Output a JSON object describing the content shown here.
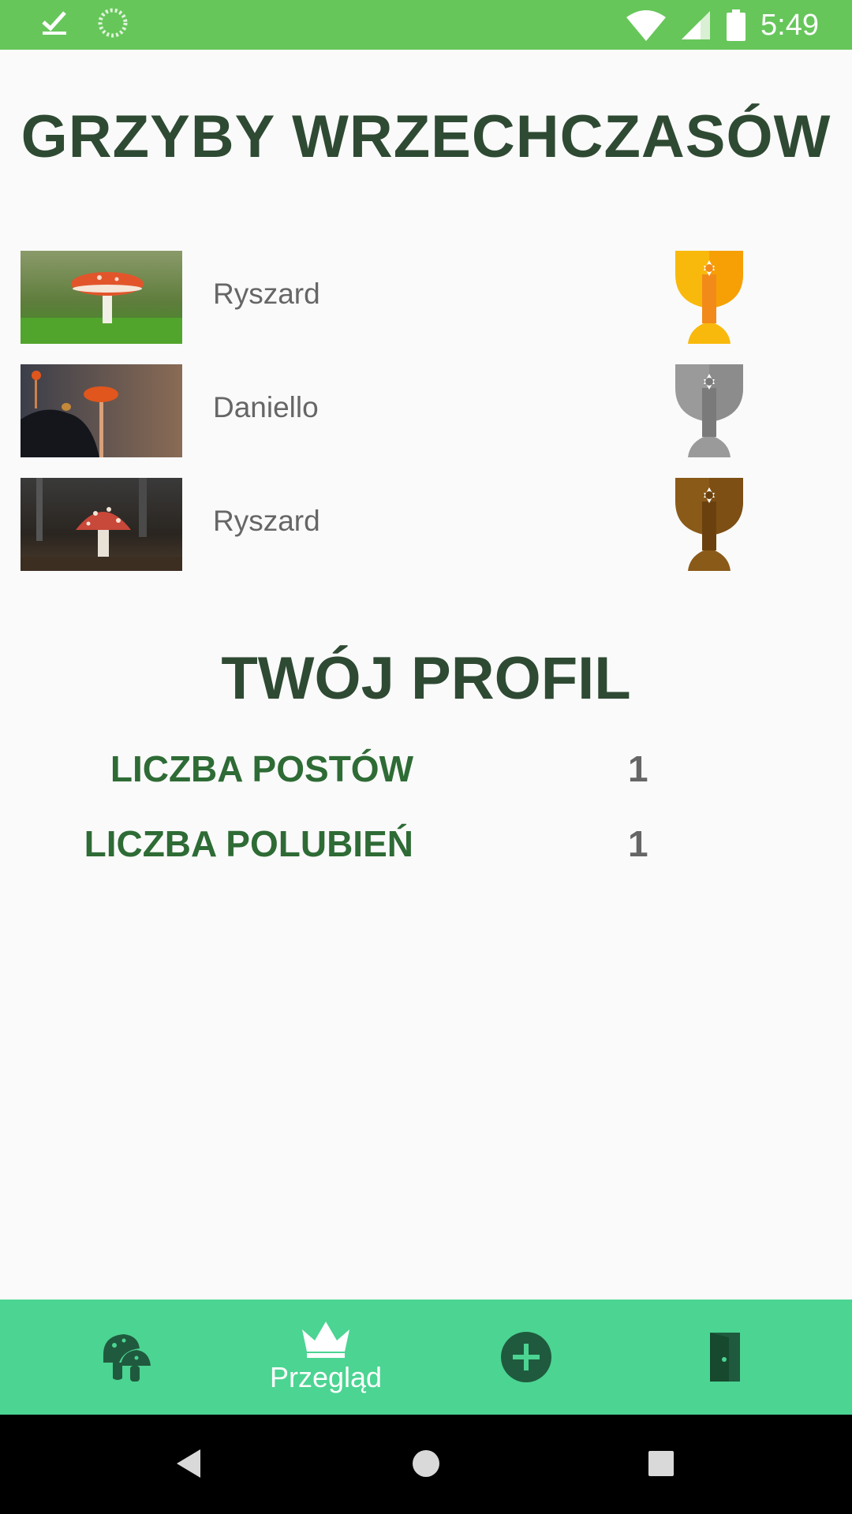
{
  "status_bar": {
    "time": "5:49",
    "icons": [
      "check-icon",
      "loading-icon",
      "wifi-icon",
      "signal-icon",
      "battery-icon"
    ]
  },
  "top_section": {
    "title": "GRZYBY WRZECHCZASÓW",
    "entries": [
      {
        "name": "Ryszard",
        "trophy": "gold-trophy-icon"
      },
      {
        "name": "Daniello",
        "trophy": "silver-trophy-icon"
      },
      {
        "name": "Ryszard",
        "trophy": "bronze-trophy-icon"
      }
    ]
  },
  "profile": {
    "title": "TWÓJ PROFIL",
    "stats": [
      {
        "label": "LICZBA POSTÓW",
        "value": "1"
      },
      {
        "label": "LICZBA POLUBIEŃ",
        "value": "1"
      }
    ]
  },
  "bottom_nav": {
    "items": [
      {
        "icon": "mushrooms-icon",
        "label": ""
      },
      {
        "icon": "crown-icon",
        "label": "Przegląd"
      },
      {
        "icon": "add-circle-icon",
        "label": ""
      },
      {
        "icon": "door-exit-icon",
        "label": ""
      }
    ]
  },
  "colors": {
    "status_bar": "#66c65a",
    "bottom_nav": "#4cd492",
    "title": "#2f4a33",
    "stat_label": "#2e6b35",
    "gold": "#f9b90c",
    "silver": "#8f8f8f",
    "bronze": "#7d4f14"
  }
}
